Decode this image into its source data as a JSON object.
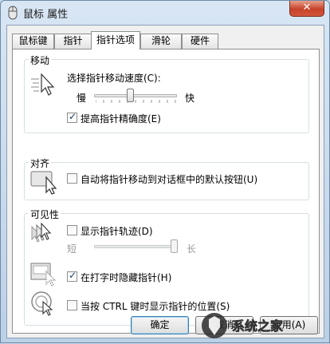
{
  "window": {
    "title": "鼠标 属性"
  },
  "tabs": [
    {
      "label": "鼠标键"
    },
    {
      "label": "指针"
    },
    {
      "label": "指针选项"
    },
    {
      "label": "滑轮"
    },
    {
      "label": "硬件"
    }
  ],
  "motion": {
    "title": "移动",
    "speed_label": "选择指针移动速度(C):",
    "slow": "慢",
    "fast": "快",
    "speed_level": 0.45,
    "precision_label": "提高指针精确度(E)",
    "precision_checked": true
  },
  "snap": {
    "title": "对齐",
    "label": "自动将指针移动到对话框中的默认按钮(U)",
    "checked": false
  },
  "visibility": {
    "title": "可见性",
    "trails_label": "显示指针轨迹(D)",
    "trails_checked": false,
    "short": "短",
    "long": "长",
    "trails_level": 1.0,
    "hide_label": "在打字时隐藏指针(H)",
    "hide_checked": true,
    "ctrl_label": "当按 CTRL 键时显示指针的位置(S)",
    "ctrl_checked": false
  },
  "buttons": {
    "ok": "确定",
    "cancel": "取消",
    "apply": "应用(A)"
  },
  "watermark": {
    "text": "系统之家"
  },
  "colors": {
    "accent": "#3c7fb1",
    "close": "#c7432a"
  }
}
